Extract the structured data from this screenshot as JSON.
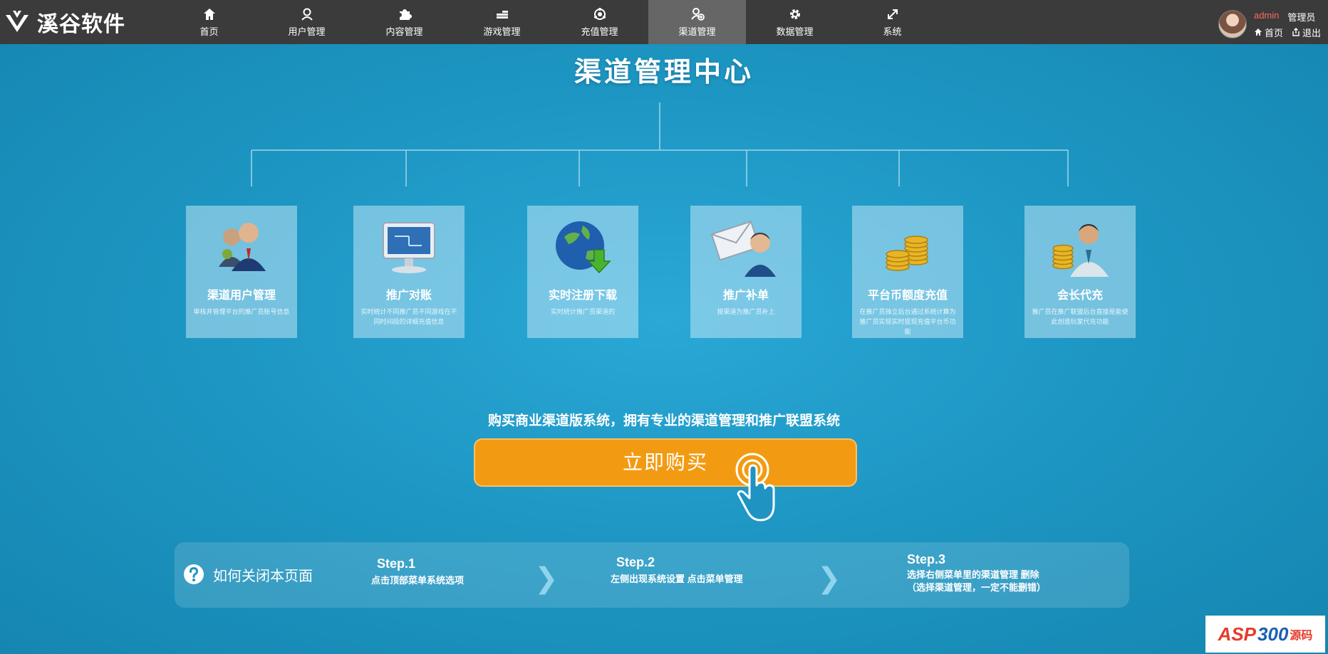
{
  "brand": {
    "name": "溪谷软件"
  },
  "nav": {
    "items": [
      {
        "label": "首页",
        "icon": "home-icon"
      },
      {
        "label": "用户管理",
        "icon": "user-icon"
      },
      {
        "label": "内容管理",
        "icon": "puzzle-icon"
      },
      {
        "label": "游戏管理",
        "icon": "coins-icon"
      },
      {
        "label": "充值管理",
        "icon": "recharge-icon"
      },
      {
        "label": "渠道管理",
        "icon": "channel-icon",
        "active": true
      },
      {
        "label": "数据管理",
        "icon": "gear-icon"
      },
      {
        "label": "系统",
        "icon": "expand-icon"
      }
    ]
  },
  "user": {
    "name": "admin",
    "role": "管理员",
    "home_link": "首页",
    "logout_link": "退出"
  },
  "main": {
    "title": "渠道管理中心",
    "cards": [
      {
        "title": "渠道用户管理",
        "desc": "审核并管理平台的推广员账号信息"
      },
      {
        "title": "推广对账",
        "desc": "实时统计不同推广员不同游戏在不同时间段的详细充值信息"
      },
      {
        "title": "实时注册下载",
        "desc": "实时统计推广员渠道的"
      },
      {
        "title": "推广补单",
        "desc": "按渠道为推广员补上"
      },
      {
        "title": "平台币额度充值",
        "desc": "在推广员独立后台通过系统计算为推广员实现实时提现充值平台币功能"
      },
      {
        "title": "会长代充",
        "desc": "推广员在推广联盟后台直接是能使此创造玩家代充功能"
      }
    ],
    "promo": "购买商业渠道版系统，拥有专业的渠道管理和推广联盟系统",
    "buy_button": "立即购买"
  },
  "steps": {
    "help_label": "如何关闭本页面",
    "items": [
      {
        "title": "Step.1",
        "desc": "点击顶部菜单系统选项"
      },
      {
        "title": "Step.2",
        "desc": "左侧出现系统设置 点击菜单管理"
      },
      {
        "title": "Step.3",
        "desc": "选择右侧菜单里的渠道管理 删除",
        "desc2": "（选择渠道管理，一定不能删错）"
      }
    ]
  },
  "watermark": {
    "a": "ASP",
    "b": "300",
    "c": "源码"
  },
  "colors": {
    "topbar": "#3b3b3b",
    "active_nav": "#666666",
    "background": "#1b93bd",
    "buy_button": "#f29b12",
    "username": "#ff6a5c"
  }
}
